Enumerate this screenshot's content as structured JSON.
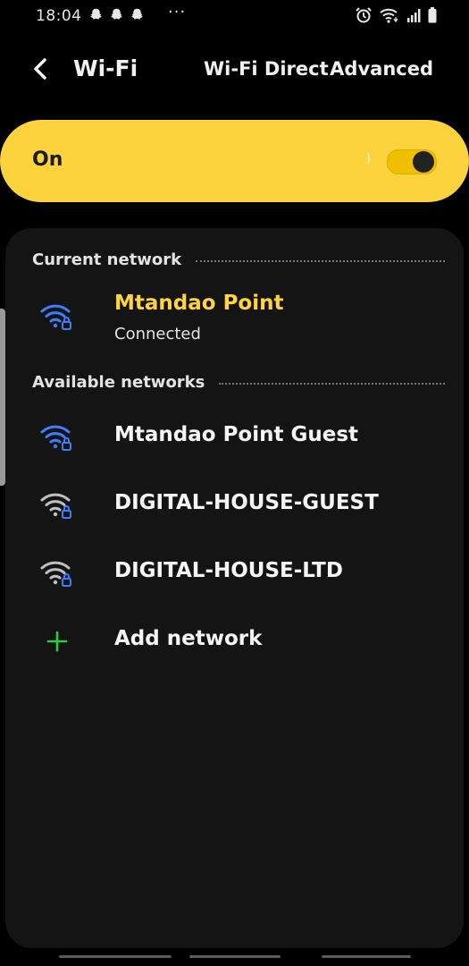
{
  "status_bar": {
    "time": "18:04",
    "left_icons": [
      "snapchat-icon",
      "snapchat-icon",
      "snapchat-icon"
    ],
    "more_indicator": "···",
    "right_icons": [
      "alarm-icon",
      "wifi-icon",
      "signal-icon",
      "battery-icon"
    ]
  },
  "app_bar": {
    "title": "Wi-Fi",
    "actions": [
      "Wi-Fi Direct",
      "Advanced"
    ]
  },
  "master_toggle": {
    "label": "On",
    "state": "on"
  },
  "current_network": {
    "header": "Current network",
    "name": "Mtandao Point",
    "status": "Connected"
  },
  "available_networks": {
    "header": "Available networks",
    "items": [
      {
        "name": "Mtandao Point Guest",
        "secured": true
      },
      {
        "name": "DIGITAL-HOUSE-GUEST",
        "secured": true
      },
      {
        "name": "DIGITAL-HOUSE-LTD",
        "secured": true
      }
    ],
    "add_label": "Add network"
  },
  "colors": {
    "accent_yellow": "#fdd33d",
    "current_network_text": "#ffd440",
    "wifi_blue": "#3d7eff",
    "wifi_grey": "#bfbfbf",
    "add_green": "#2ecc40",
    "background": "#000000",
    "card": "#141414"
  }
}
